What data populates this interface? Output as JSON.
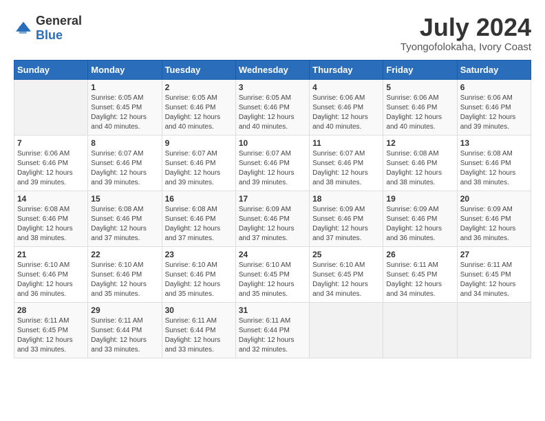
{
  "logo": {
    "text_general": "General",
    "text_blue": "Blue"
  },
  "title": {
    "month": "July 2024",
    "location": "Tyongofolokaha, Ivory Coast"
  },
  "calendar": {
    "headers": [
      "Sunday",
      "Monday",
      "Tuesday",
      "Wednesday",
      "Thursday",
      "Friday",
      "Saturday"
    ],
    "weeks": [
      [
        {
          "day": "",
          "sunrise": "",
          "sunset": "",
          "daylight": ""
        },
        {
          "day": "1",
          "sunrise": "Sunrise: 6:05 AM",
          "sunset": "Sunset: 6:45 PM",
          "daylight": "Daylight: 12 hours and 40 minutes."
        },
        {
          "day": "2",
          "sunrise": "Sunrise: 6:05 AM",
          "sunset": "Sunset: 6:46 PM",
          "daylight": "Daylight: 12 hours and 40 minutes."
        },
        {
          "day": "3",
          "sunrise": "Sunrise: 6:05 AM",
          "sunset": "Sunset: 6:46 PM",
          "daylight": "Daylight: 12 hours and 40 minutes."
        },
        {
          "day": "4",
          "sunrise": "Sunrise: 6:06 AM",
          "sunset": "Sunset: 6:46 PM",
          "daylight": "Daylight: 12 hours and 40 minutes."
        },
        {
          "day": "5",
          "sunrise": "Sunrise: 6:06 AM",
          "sunset": "Sunset: 6:46 PM",
          "daylight": "Daylight: 12 hours and 40 minutes."
        },
        {
          "day": "6",
          "sunrise": "Sunrise: 6:06 AM",
          "sunset": "Sunset: 6:46 PM",
          "daylight": "Daylight: 12 hours and 39 minutes."
        }
      ],
      [
        {
          "day": "7",
          "sunrise": "Sunrise: 6:06 AM",
          "sunset": "Sunset: 6:46 PM",
          "daylight": "Daylight: 12 hours and 39 minutes."
        },
        {
          "day": "8",
          "sunrise": "Sunrise: 6:07 AM",
          "sunset": "Sunset: 6:46 PM",
          "daylight": "Daylight: 12 hours and 39 minutes."
        },
        {
          "day": "9",
          "sunrise": "Sunrise: 6:07 AM",
          "sunset": "Sunset: 6:46 PM",
          "daylight": "Daylight: 12 hours and 39 minutes."
        },
        {
          "day": "10",
          "sunrise": "Sunrise: 6:07 AM",
          "sunset": "Sunset: 6:46 PM",
          "daylight": "Daylight: 12 hours and 39 minutes."
        },
        {
          "day": "11",
          "sunrise": "Sunrise: 6:07 AM",
          "sunset": "Sunset: 6:46 PM",
          "daylight": "Daylight: 12 hours and 38 minutes."
        },
        {
          "day": "12",
          "sunrise": "Sunrise: 6:08 AM",
          "sunset": "Sunset: 6:46 PM",
          "daylight": "Daylight: 12 hours and 38 minutes."
        },
        {
          "day": "13",
          "sunrise": "Sunrise: 6:08 AM",
          "sunset": "Sunset: 6:46 PM",
          "daylight": "Daylight: 12 hours and 38 minutes."
        }
      ],
      [
        {
          "day": "14",
          "sunrise": "Sunrise: 6:08 AM",
          "sunset": "Sunset: 6:46 PM",
          "daylight": "Daylight: 12 hours and 38 minutes."
        },
        {
          "day": "15",
          "sunrise": "Sunrise: 6:08 AM",
          "sunset": "Sunset: 6:46 PM",
          "daylight": "Daylight: 12 hours and 37 minutes."
        },
        {
          "day": "16",
          "sunrise": "Sunrise: 6:08 AM",
          "sunset": "Sunset: 6:46 PM",
          "daylight": "Daylight: 12 hours and 37 minutes."
        },
        {
          "day": "17",
          "sunrise": "Sunrise: 6:09 AM",
          "sunset": "Sunset: 6:46 PM",
          "daylight": "Daylight: 12 hours and 37 minutes."
        },
        {
          "day": "18",
          "sunrise": "Sunrise: 6:09 AM",
          "sunset": "Sunset: 6:46 PM",
          "daylight": "Daylight: 12 hours and 37 minutes."
        },
        {
          "day": "19",
          "sunrise": "Sunrise: 6:09 AM",
          "sunset": "Sunset: 6:46 PM",
          "daylight": "Daylight: 12 hours and 36 minutes."
        },
        {
          "day": "20",
          "sunrise": "Sunrise: 6:09 AM",
          "sunset": "Sunset: 6:46 PM",
          "daylight": "Daylight: 12 hours and 36 minutes."
        }
      ],
      [
        {
          "day": "21",
          "sunrise": "Sunrise: 6:10 AM",
          "sunset": "Sunset: 6:46 PM",
          "daylight": "Daylight: 12 hours and 36 minutes."
        },
        {
          "day": "22",
          "sunrise": "Sunrise: 6:10 AM",
          "sunset": "Sunset: 6:46 PM",
          "daylight": "Daylight: 12 hours and 35 minutes."
        },
        {
          "day": "23",
          "sunrise": "Sunrise: 6:10 AM",
          "sunset": "Sunset: 6:46 PM",
          "daylight": "Daylight: 12 hours and 35 minutes."
        },
        {
          "day": "24",
          "sunrise": "Sunrise: 6:10 AM",
          "sunset": "Sunset: 6:45 PM",
          "daylight": "Daylight: 12 hours and 35 minutes."
        },
        {
          "day": "25",
          "sunrise": "Sunrise: 6:10 AM",
          "sunset": "Sunset: 6:45 PM",
          "daylight": "Daylight: 12 hours and 34 minutes."
        },
        {
          "day": "26",
          "sunrise": "Sunrise: 6:11 AM",
          "sunset": "Sunset: 6:45 PM",
          "daylight": "Daylight: 12 hours and 34 minutes."
        },
        {
          "day": "27",
          "sunrise": "Sunrise: 6:11 AM",
          "sunset": "Sunset: 6:45 PM",
          "daylight": "Daylight: 12 hours and 34 minutes."
        }
      ],
      [
        {
          "day": "28",
          "sunrise": "Sunrise: 6:11 AM",
          "sunset": "Sunset: 6:45 PM",
          "daylight": "Daylight: 12 hours and 33 minutes."
        },
        {
          "day": "29",
          "sunrise": "Sunrise: 6:11 AM",
          "sunset": "Sunset: 6:44 PM",
          "daylight": "Daylight: 12 hours and 33 minutes."
        },
        {
          "day": "30",
          "sunrise": "Sunrise: 6:11 AM",
          "sunset": "Sunset: 6:44 PM",
          "daylight": "Daylight: 12 hours and 33 minutes."
        },
        {
          "day": "31",
          "sunrise": "Sunrise: 6:11 AM",
          "sunset": "Sunset: 6:44 PM",
          "daylight": "Daylight: 12 hours and 32 minutes."
        },
        {
          "day": "",
          "sunrise": "",
          "sunset": "",
          "daylight": ""
        },
        {
          "day": "",
          "sunrise": "",
          "sunset": "",
          "daylight": ""
        },
        {
          "day": "",
          "sunrise": "",
          "sunset": "",
          "daylight": ""
        }
      ]
    ]
  }
}
